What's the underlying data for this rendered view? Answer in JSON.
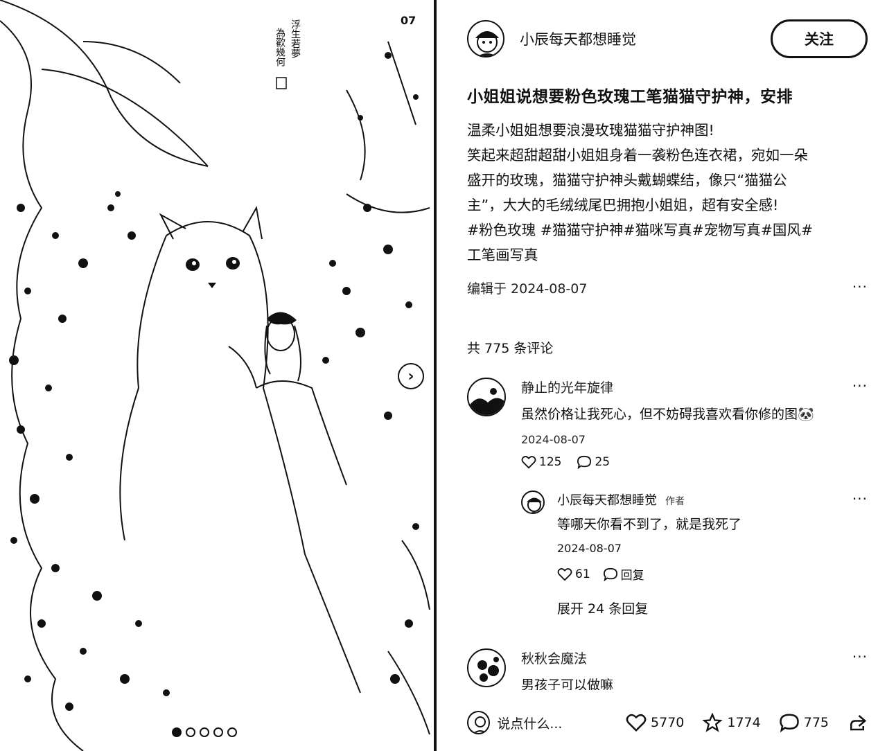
{
  "image": {
    "counter": "07",
    "caption_lines": [
      "浮生若夢",
      "為歡幾何"
    ],
    "dots": [
      true,
      false,
      false,
      false,
      false
    ]
  },
  "author": {
    "name": "小辰每天都想睡觉",
    "follow_label": "关注"
  },
  "post": {
    "title": "小姐姐说想要粉色玫瑰工笔猫猫守护神，安排",
    "body_lines": [
      "温柔小姐姐想要浪漫玫瑰猫猫守护神图!",
      "笑起来超甜超甜小姐姐身着一袭粉色连衣裙，宛如一朵",
      "盛开的玫瑰，猫猫守护神头戴蝴蝶结，像只“猫猫公",
      "主”，大大的毛绒绒尾巴拥抱小姐姐，超有安全感!",
      "#粉色玫瑰 #猫猫守护神#猫咪写真#宠物写真#国风#",
      "工笔画写真"
    ],
    "edit_info": "编辑于 2024-08-07",
    "more": "···"
  },
  "comments_header": "共 775 条评论",
  "comments": [
    {
      "user": "静止的光年旋律",
      "text": "虽然价格让我死心，但不妨碍我喜欢看你修的图",
      "emoji": "🐼",
      "date": "2024-08-07",
      "likes": "125",
      "replies_count": "25",
      "more": "···"
    },
    {
      "user": "秋秋会魔法",
      "text": "男孩子可以做嘛",
      "more": "···"
    }
  ],
  "reply": {
    "user": "小辰每天都想睡觉",
    "tag": "作者",
    "text": "等哪天你看不到了，就是我死了",
    "date": "2024-08-07",
    "likes": "61",
    "reply_label": "回复",
    "more": "···"
  },
  "expand_label": "展开 24 条回复",
  "bottom": {
    "input_placeholder": "说点什么...",
    "likes": "5770",
    "favorites": "1774",
    "comments": "775"
  }
}
